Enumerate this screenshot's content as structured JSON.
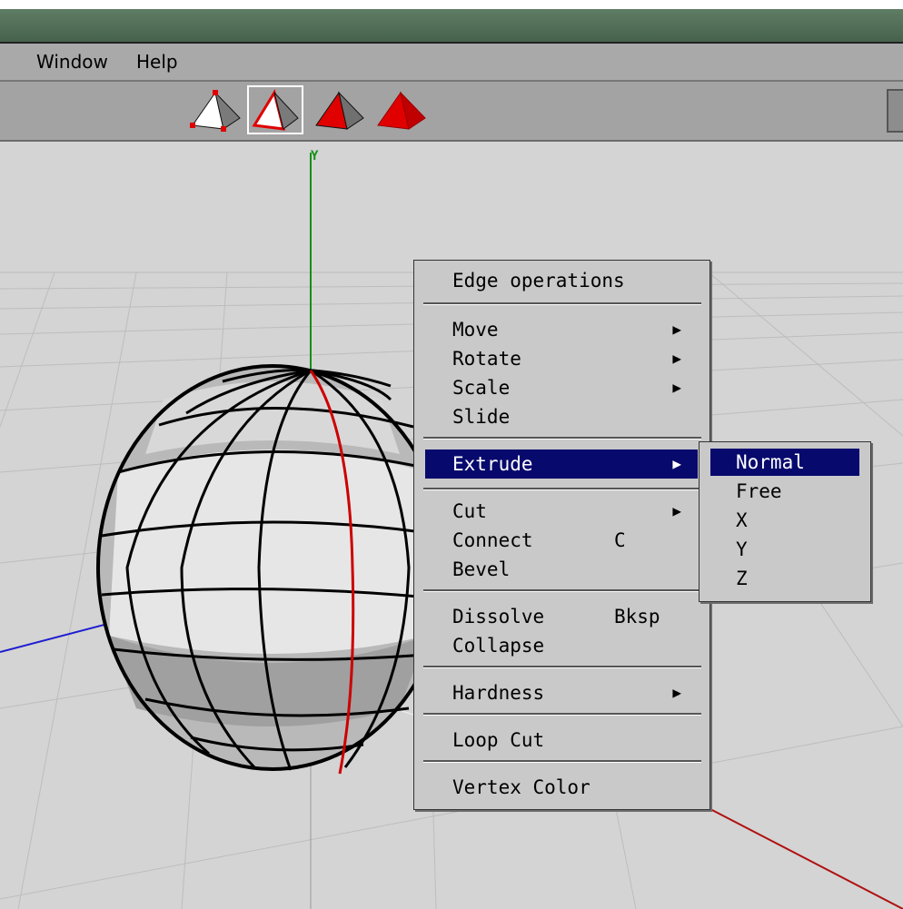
{
  "menubar": {
    "items": [
      "Window",
      "Help"
    ]
  },
  "toolbar": {
    "tools": [
      {
        "name": "vertex-select"
      },
      {
        "name": "edge-select"
      },
      {
        "name": "face-select"
      },
      {
        "name": "object-select"
      }
    ]
  },
  "viewport": {
    "axis_label": "Y"
  },
  "context_menu": {
    "title": "Edge operations",
    "groups": [
      [
        {
          "label": "Move",
          "submenu": true
        },
        {
          "label": "Rotate",
          "submenu": true
        },
        {
          "label": "Scale",
          "submenu": true
        },
        {
          "label": "Slide",
          "submenu": false
        }
      ],
      [
        {
          "label": "Extrude",
          "submenu": true,
          "highlighted": true
        }
      ],
      [
        {
          "label": "Cut",
          "submenu": true
        },
        {
          "label": "Connect",
          "shortcut": "C"
        },
        {
          "label": "Bevel"
        }
      ],
      [
        {
          "label": "Dissolve",
          "shortcut": "Bksp"
        },
        {
          "label": "Collapse"
        }
      ],
      [
        {
          "label": "Hardness",
          "submenu": true
        }
      ],
      [
        {
          "label": "Loop Cut"
        }
      ],
      [
        {
          "label": "Vertex Color"
        }
      ]
    ],
    "submenu_arrow": "▶"
  },
  "extrude_submenu": {
    "items": [
      "Normal",
      "Free",
      "X",
      "Y",
      "Z"
    ],
    "highlighted": "Normal"
  },
  "colors": {
    "highlight": "#07096d",
    "edge_selected": "#cc0000",
    "axis_y": "#159015",
    "axis_x": "#b01010",
    "axis_z": "#1d1dd0"
  }
}
